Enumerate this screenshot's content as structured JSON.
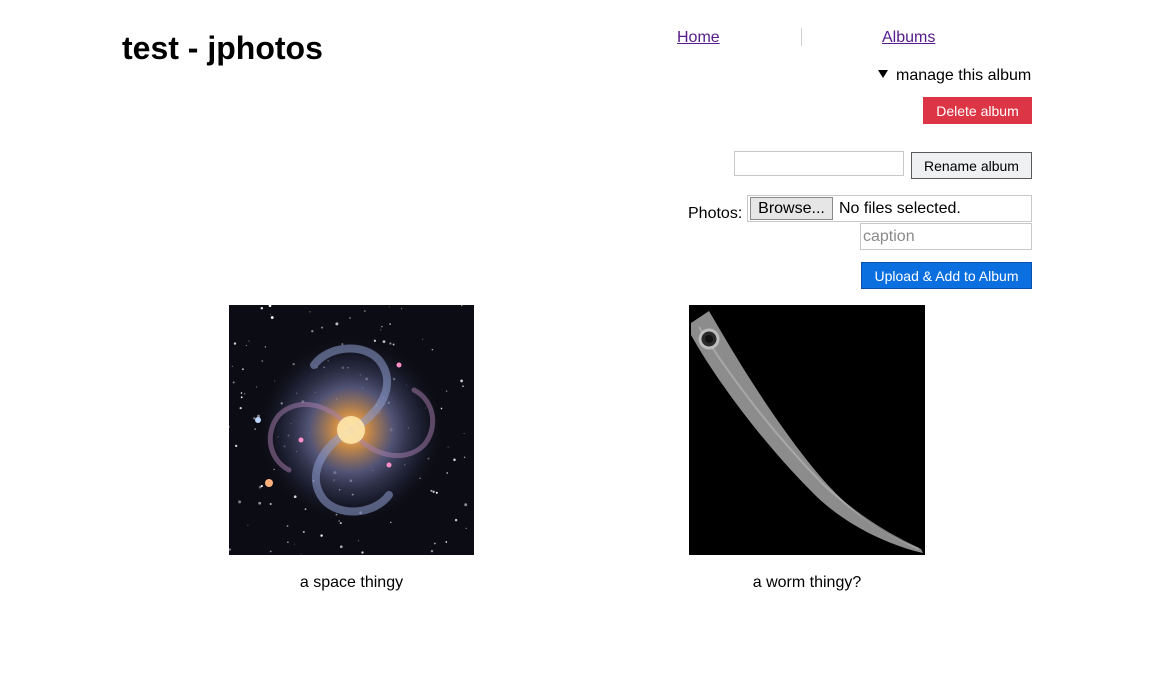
{
  "header": {
    "title": "test - jphotos",
    "nav": {
      "home": "Home",
      "albums": "Albums"
    }
  },
  "manage": {
    "summary": "manage this album",
    "delete_label": "Delete album",
    "rename_value": "",
    "rename_label": "Rename album",
    "upload": {
      "photos_label": "Photos:",
      "browse_label": "Browse...",
      "file_status": "No files selected.",
      "caption_placeholder": "caption",
      "submit_label": "Upload & Add to Album"
    }
  },
  "photos": [
    {
      "caption": "a space thingy",
      "icon": "galaxy-image"
    },
    {
      "caption": "a worm thingy?",
      "icon": "worm-image"
    }
  ],
  "colors": {
    "link": "#551a8b",
    "danger": "#dc3545",
    "primary": "#0b6fe0"
  }
}
